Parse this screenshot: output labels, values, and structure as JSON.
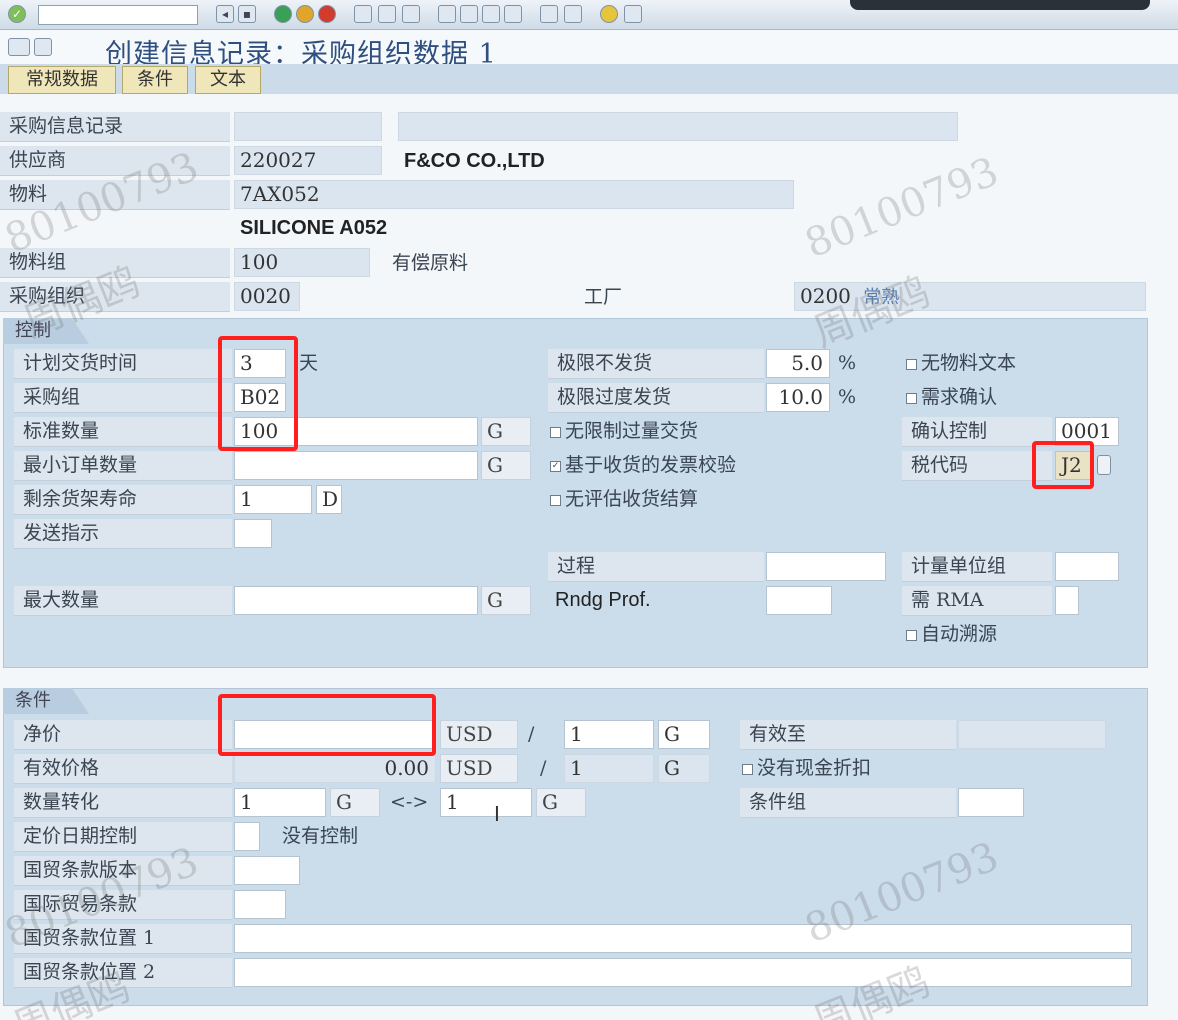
{
  "window": {
    "title": "创建信息记录：采购组织数据 1"
  },
  "app_toolbar": {
    "buttons": [
      "常规数据",
      "条件",
      "文本"
    ]
  },
  "header": {
    "info_record_label": "采购信息记录",
    "info_record_value": "",
    "vendor_label": "供应商",
    "vendor_value": "220027",
    "vendor_name": "F&CO CO.,LTD",
    "material_label": "物料",
    "material_value": "7AX052",
    "material_desc": "SILICONE A052",
    "material_group_label": "物料组",
    "material_group_value": "100",
    "material_group_desc": "有偿原料",
    "purch_org_label": "采购组织",
    "purch_org_value": "0020",
    "plant_label": "工厂",
    "plant_value": "0200",
    "plant_desc": "常熟"
  },
  "control": {
    "group_title": "控制",
    "planned_delivery_label": "计划交货时间",
    "planned_delivery_value": "3",
    "planned_delivery_unit": "天",
    "purch_group_label": "采购组",
    "purch_group_value": "B02",
    "std_qty_label": "标准数量",
    "std_qty_value": "100",
    "std_qty_unit": "G",
    "min_order_label": "最小订单数量",
    "min_order_value": "",
    "min_order_unit": "G",
    "shelf_life_label": "剩余货架寿命",
    "shelf_life_value": "1",
    "shelf_life_unit": "D",
    "shipping_label": "发送指示",
    "max_qty_label": "最大数量",
    "max_qty_unit": "G",
    "underdel_label": "极限不发货",
    "underdel_value": "5.0",
    "underdel_unit": "%",
    "overdel_label": "极限过度发货",
    "overdel_value": "10.0",
    "overdel_unit": "%",
    "unlimited_label": "无限制过量交货",
    "unlimited_checked": false,
    "gr_iv_label": "基于收货的发票校验",
    "gr_iv_checked": true,
    "ers_label": "无评估收货结算",
    "ers_checked": false,
    "no_mat_text_label": "无物料文本",
    "ack_req_label": "需求确认",
    "conf_ctrl_label": "确认控制",
    "conf_ctrl_value": "0001",
    "tax_code_label": "税代码",
    "tax_code_value": "J2",
    "procedure_label": "过程",
    "rndg_label": "Rndg Prof.",
    "unit_group_label": "计量单位组",
    "rma_label": "需 RMA",
    "auto_source_label": "自动溯源"
  },
  "conditions": {
    "group_title": "条件",
    "net_price_label": "净价",
    "net_price_value": "",
    "net_currency": "USD",
    "slash": "/",
    "per_value": "1",
    "per_unit": "G",
    "valid_to_label": "有效至",
    "eff_price_label": "有效价格",
    "eff_price_value": "0.00",
    "eff_currency": "USD",
    "eff_per_value": "1",
    "eff_per_unit": "G",
    "no_cash_disc_label": "没有现金折扣",
    "qty_conv_label": "数量转化",
    "qty_conv_left": "1",
    "qty_conv_left_unit": "G",
    "arrow": "<->",
    "qty_conv_right": "1",
    "qty_conv_right_unit": "G",
    "cond_group_label": "条件组",
    "price_date_label": "定价日期控制",
    "price_date_desc": "没有控制",
    "incoterms_version_label": "国贸条款版本",
    "incoterms_label": "国际贸易条款",
    "incoterms_loc1_label": "国贸条款位置 1",
    "incoterms_loc2_label": "国贸条款位置 2"
  },
  "watermarks": [
    "80100793",
    "周偶鸥"
  ]
}
